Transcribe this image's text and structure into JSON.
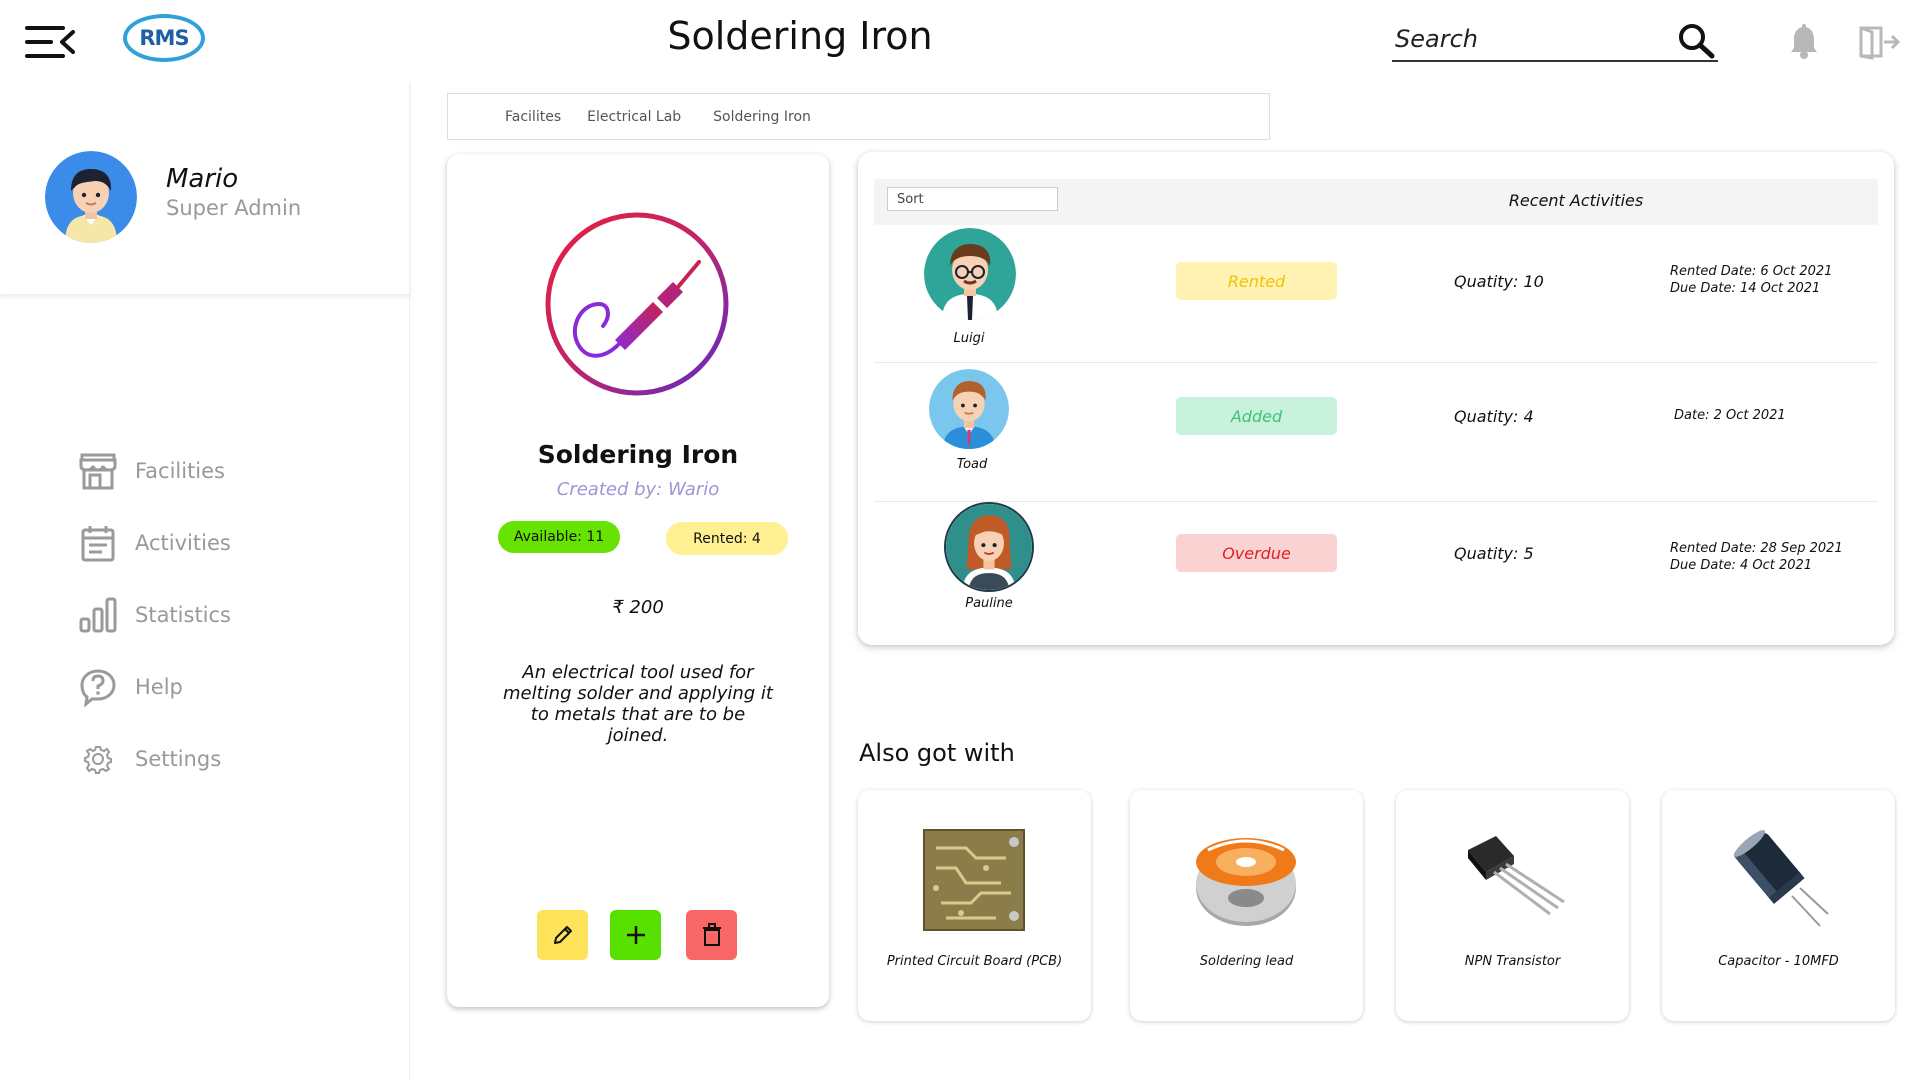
{
  "header": {
    "logo_text": "RMS",
    "title": "Soldering Iron",
    "search_placeholder": "Search"
  },
  "profile": {
    "name": "Mario",
    "role": "Super Admin"
  },
  "sidebar": {
    "items": [
      {
        "label": "Facilities",
        "icon": "store-icon"
      },
      {
        "label": "Activities",
        "icon": "calendar-icon"
      },
      {
        "label": "Statistics",
        "icon": "bar-chart-icon"
      },
      {
        "label": "Help",
        "icon": "help-icon"
      },
      {
        "label": "Settings",
        "icon": "gear-icon"
      }
    ]
  },
  "breadcrumb": [
    "Facilites",
    "Electrical Lab",
    "Soldering Iron"
  ],
  "item": {
    "name": "Soldering Iron",
    "created_by": "Created by: Wario",
    "available": "Available: 11",
    "rented": "Rented: 4",
    "price": "₹ 200",
    "description": "An electrical tool used for melting solder and applying it to metals that are to be joined.",
    "icon": "soldering-iron-icon"
  },
  "activities": {
    "sort_label": "Sort",
    "title": "Recent Activities",
    "rows": [
      {
        "user": "Luigi",
        "status": "Rented",
        "quantity": "Quatity: 10",
        "date1": "Rented Date: 6 Oct 2021",
        "date2": "Due Date: 14 Oct 2021"
      },
      {
        "user": "Toad",
        "status": "Added",
        "quantity": "Quatity: 4",
        "date1": "Date: 2 Oct 2021",
        "date2": ""
      },
      {
        "user": "Pauline",
        "status": "Overdue",
        "quantity": "Quatity: 5",
        "date1": "Rented Date: 28 Sep 2021",
        "date2": "Due Date: 4 Oct 2021"
      }
    ]
  },
  "also_got_with": {
    "title": "Also got with",
    "products": [
      {
        "name": "Printed Circuit Board (PCB)"
      },
      {
        "name": "Soldering lead"
      },
      {
        "name": "NPN Transistor"
      },
      {
        "name": "Capacitor - 10MFD"
      }
    ]
  },
  "colors": {
    "available": "#66e300",
    "rented_pill": "#fff091",
    "status_rented_bg": "#fff2b3",
    "status_rented_text": "#f2c300",
    "status_added_bg": "#c9f2dc",
    "status_added_text": "#3fc27a",
    "status_overdue_bg": "#fad2d2",
    "status_overdue_text": "#e02020",
    "edit": "#fde25a",
    "add": "#58e000",
    "delete": "#f86666"
  }
}
